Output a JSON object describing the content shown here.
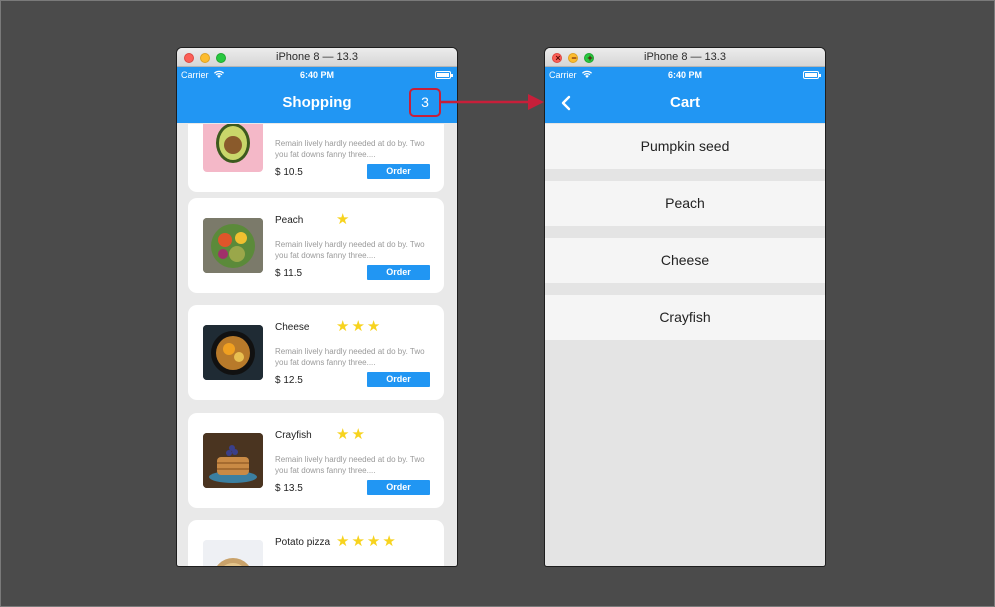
{
  "left_window": {
    "title": "iPhone 8 — 13.3",
    "status": {
      "carrier": "Carrier",
      "time": "6:40 PM"
    },
    "appbar": {
      "title": "Shopping",
      "cart_count": "3"
    },
    "products": [
      {
        "name": "",
        "rating": 0,
        "stars": "",
        "description": "Remain lively hardly needed at do by. Two you fat downs fanny three....",
        "price": "$ 10.5",
        "order_label": "Order",
        "image_icon": "avocado"
      },
      {
        "name": "Peach",
        "rating": 1,
        "stars": "★",
        "description": "Remain lively hardly needed at do by. Two you fat downs fanny three....",
        "price": "$ 11.5",
        "order_label": "Order",
        "image_icon": "salad-bowl"
      },
      {
        "name": "Cheese",
        "rating": 3,
        "stars": "★★★",
        "description": "Remain lively hardly needed at do by. Two you fat downs fanny three....",
        "price": "$ 12.5",
        "order_label": "Order",
        "image_icon": "skillet-dish"
      },
      {
        "name": "Crayfish",
        "rating": 2,
        "stars": "★★",
        "description": "Remain lively hardly needed at do by. Two you fat downs fanny three....",
        "price": "$ 13.5",
        "order_label": "Order",
        "image_icon": "pancake-stack"
      },
      {
        "name": "Potato pizza",
        "rating": 4,
        "stars": "★★★★",
        "description": "",
        "price": "",
        "order_label": "",
        "image_icon": "pizza"
      }
    ]
  },
  "right_window": {
    "title": "iPhone 8 — 13.3",
    "status": {
      "carrier": "Carrier",
      "time": "6:40 PM"
    },
    "appbar": {
      "title": "Cart"
    },
    "cart_items": [
      "Pumpkin seed",
      "Peach",
      "Cheese",
      "Crayfish"
    ]
  },
  "colors": {
    "app_blue": "#2196f3",
    "star_yellow": "#f7d31e",
    "highlight_red": "#c71f3a",
    "background": "#4b4b4b"
  }
}
